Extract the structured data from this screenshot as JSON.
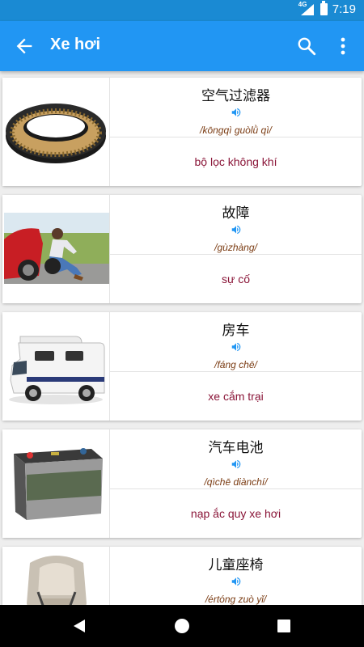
{
  "status": {
    "network": "4G",
    "time": "7:19"
  },
  "app_bar": {
    "title": "Xe hơi",
    "back_icon": "arrow-back-icon",
    "search_icon": "search-icon",
    "menu_icon": "more-vert-icon"
  },
  "cards": [
    {
      "word": "空气过滤器",
      "pinyin": "/kōngqì guòlǜ qì/",
      "meaning": "bộ lọc không khí",
      "image": "air-filter-image"
    },
    {
      "word": "故障",
      "pinyin": "/gùzhàng/",
      "meaning": "sự cố",
      "image": "breakdown-image"
    },
    {
      "word": "房车",
      "pinyin": "/fáng chē/",
      "meaning": "xe cắm trại",
      "image": "camper-van-image"
    },
    {
      "word": "汽车电池",
      "pinyin": "/qìchē diànchí/",
      "meaning": "nạp ắc quy xe hơi",
      "image": "car-battery-image"
    },
    {
      "word": "儿童座椅",
      "pinyin": "/értóng zuò yǐ/",
      "meaning": "",
      "image": "child-seat-image"
    }
  ],
  "colors": {
    "status_bar": "#1a8ad3",
    "app_bar": "#2196f3",
    "pinyin": "#7a3b12",
    "meaning": "#8a1538",
    "speaker": "#2196f3"
  }
}
